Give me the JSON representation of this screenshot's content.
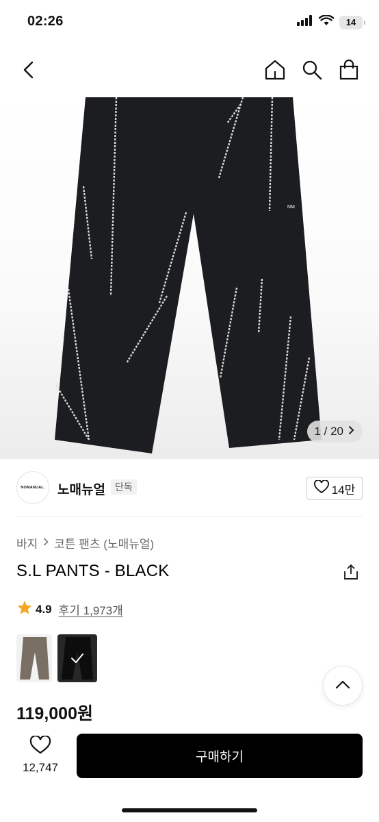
{
  "status_bar": {
    "time": "02:26",
    "battery": "14"
  },
  "nav": {
    "back": "back",
    "home": "home",
    "search": "search",
    "cart": "cart"
  },
  "image": {
    "counter": "1 / 20",
    "garment_mark": "NM"
  },
  "brand": {
    "logo_text": "NOMANUAL.",
    "name": "노매뉴얼",
    "badge": "단독",
    "likes": "14만"
  },
  "breadcrumb": {
    "category": "바지",
    "subcategory": "코튼 팬츠 (노매뉴얼)"
  },
  "product": {
    "title": "S.L PANTS - BLACK",
    "rating": "4.9",
    "reviews": "후기 1,973개",
    "price": "119,000원"
  },
  "colors": {
    "accent": "#F5A623",
    "buy_button": "#000000"
  },
  "bottom": {
    "wish_count": "12,747",
    "buy_label": "구매하기"
  }
}
